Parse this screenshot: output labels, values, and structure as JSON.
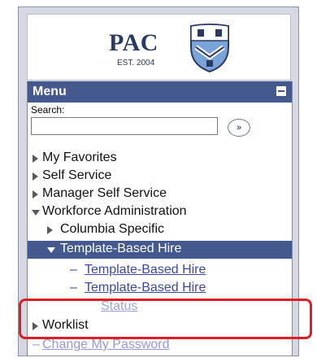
{
  "logo": {
    "name": "PAC",
    "est": "EST. 2004"
  },
  "menu": {
    "title": "Menu",
    "search_label": "Search:",
    "search_value": "",
    "go_label": "»",
    "items": [
      {
        "label": "My Favorites"
      },
      {
        "label": "Self Service"
      },
      {
        "label": "Manager Self Service"
      },
      {
        "label": "Workforce Administration"
      },
      {
        "label": "Columbia Specific"
      },
      {
        "label": "Template-Based Hire"
      },
      {
        "label": "Template-Based Hire"
      },
      {
        "label": "Template-Based Hire"
      },
      {
        "label": "Status"
      },
      {
        "label": "Worklist"
      },
      {
        "label": "Change My Password"
      }
    ]
  },
  "colors": {
    "header": "#44598d",
    "link": "#3a49a8",
    "highlight": "#e01d24"
  },
  "icons": {
    "collapse": "minus-icon",
    "go": "double-chevron-right-icon",
    "collapsed": "triangle-right-icon",
    "expanded": "triangle-down-icon"
  }
}
